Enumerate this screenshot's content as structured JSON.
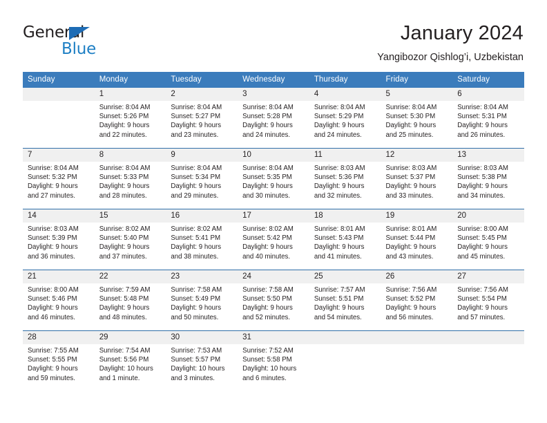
{
  "logo": {
    "word_dark": "General",
    "word_blue": "Blue",
    "triangle_color": "#1e6cb5",
    "blue_color": "#1e7fc4"
  },
  "header": {
    "title": "January 2024",
    "subtitle": "Yangibozor Qishlog’i, Uzbekistan"
  },
  "theme": {
    "header_blue": "#3b7cbc",
    "separator_blue": "#2f6ea8",
    "daynum_band": "#f0f0f0",
    "text": "#231f20"
  },
  "calendar": {
    "weekday_headers": [
      "Sunday",
      "Monday",
      "Tuesday",
      "Wednesday",
      "Thursday",
      "Friday",
      "Saturday"
    ],
    "weeks": [
      [
        {
          "day": "",
          "sunrise": "",
          "sunset": "",
          "daylight_1": "",
          "daylight_2": "",
          "empty": true
        },
        {
          "day": "1",
          "sunrise": "Sunrise: 8:04 AM",
          "sunset": "Sunset: 5:26 PM",
          "daylight_1": "Daylight: 9 hours",
          "daylight_2": "and 22 minutes."
        },
        {
          "day": "2",
          "sunrise": "Sunrise: 8:04 AM",
          "sunset": "Sunset: 5:27 PM",
          "daylight_1": "Daylight: 9 hours",
          "daylight_2": "and 23 minutes."
        },
        {
          "day": "3",
          "sunrise": "Sunrise: 8:04 AM",
          "sunset": "Sunset: 5:28 PM",
          "daylight_1": "Daylight: 9 hours",
          "daylight_2": "and 24 minutes."
        },
        {
          "day": "4",
          "sunrise": "Sunrise: 8:04 AM",
          "sunset": "Sunset: 5:29 PM",
          "daylight_1": "Daylight: 9 hours",
          "daylight_2": "and 24 minutes."
        },
        {
          "day": "5",
          "sunrise": "Sunrise: 8:04 AM",
          "sunset": "Sunset: 5:30 PM",
          "daylight_1": "Daylight: 9 hours",
          "daylight_2": "and 25 minutes."
        },
        {
          "day": "6",
          "sunrise": "Sunrise: 8:04 AM",
          "sunset": "Sunset: 5:31 PM",
          "daylight_1": "Daylight: 9 hours",
          "daylight_2": "and 26 minutes."
        }
      ],
      [
        {
          "day": "7",
          "sunrise": "Sunrise: 8:04 AM",
          "sunset": "Sunset: 5:32 PM",
          "daylight_1": "Daylight: 9 hours",
          "daylight_2": "and 27 minutes."
        },
        {
          "day": "8",
          "sunrise": "Sunrise: 8:04 AM",
          "sunset": "Sunset: 5:33 PM",
          "daylight_1": "Daylight: 9 hours",
          "daylight_2": "and 28 minutes."
        },
        {
          "day": "9",
          "sunrise": "Sunrise: 8:04 AM",
          "sunset": "Sunset: 5:34 PM",
          "daylight_1": "Daylight: 9 hours",
          "daylight_2": "and 29 minutes."
        },
        {
          "day": "10",
          "sunrise": "Sunrise: 8:04 AM",
          "sunset": "Sunset: 5:35 PM",
          "daylight_1": "Daylight: 9 hours",
          "daylight_2": "and 30 minutes."
        },
        {
          "day": "11",
          "sunrise": "Sunrise: 8:03 AM",
          "sunset": "Sunset: 5:36 PM",
          "daylight_1": "Daylight: 9 hours",
          "daylight_2": "and 32 minutes."
        },
        {
          "day": "12",
          "sunrise": "Sunrise: 8:03 AM",
          "sunset": "Sunset: 5:37 PM",
          "daylight_1": "Daylight: 9 hours",
          "daylight_2": "and 33 minutes."
        },
        {
          "day": "13",
          "sunrise": "Sunrise: 8:03 AM",
          "sunset": "Sunset: 5:38 PM",
          "daylight_1": "Daylight: 9 hours",
          "daylight_2": "and 34 minutes."
        }
      ],
      [
        {
          "day": "14",
          "sunrise": "Sunrise: 8:03 AM",
          "sunset": "Sunset: 5:39 PM",
          "daylight_1": "Daylight: 9 hours",
          "daylight_2": "and 36 minutes."
        },
        {
          "day": "15",
          "sunrise": "Sunrise: 8:02 AM",
          "sunset": "Sunset: 5:40 PM",
          "daylight_1": "Daylight: 9 hours",
          "daylight_2": "and 37 minutes."
        },
        {
          "day": "16",
          "sunrise": "Sunrise: 8:02 AM",
          "sunset": "Sunset: 5:41 PM",
          "daylight_1": "Daylight: 9 hours",
          "daylight_2": "and 38 minutes."
        },
        {
          "day": "17",
          "sunrise": "Sunrise: 8:02 AM",
          "sunset": "Sunset: 5:42 PM",
          "daylight_1": "Daylight: 9 hours",
          "daylight_2": "and 40 minutes."
        },
        {
          "day": "18",
          "sunrise": "Sunrise: 8:01 AM",
          "sunset": "Sunset: 5:43 PM",
          "daylight_1": "Daylight: 9 hours",
          "daylight_2": "and 41 minutes."
        },
        {
          "day": "19",
          "sunrise": "Sunrise: 8:01 AM",
          "sunset": "Sunset: 5:44 PM",
          "daylight_1": "Daylight: 9 hours",
          "daylight_2": "and 43 minutes."
        },
        {
          "day": "20",
          "sunrise": "Sunrise: 8:00 AM",
          "sunset": "Sunset: 5:45 PM",
          "daylight_1": "Daylight: 9 hours",
          "daylight_2": "and 45 minutes."
        }
      ],
      [
        {
          "day": "21",
          "sunrise": "Sunrise: 8:00 AM",
          "sunset": "Sunset: 5:46 PM",
          "daylight_1": "Daylight: 9 hours",
          "daylight_2": "and 46 minutes."
        },
        {
          "day": "22",
          "sunrise": "Sunrise: 7:59 AM",
          "sunset": "Sunset: 5:48 PM",
          "daylight_1": "Daylight: 9 hours",
          "daylight_2": "and 48 minutes."
        },
        {
          "day": "23",
          "sunrise": "Sunrise: 7:58 AM",
          "sunset": "Sunset: 5:49 PM",
          "daylight_1": "Daylight: 9 hours",
          "daylight_2": "and 50 minutes."
        },
        {
          "day": "24",
          "sunrise": "Sunrise: 7:58 AM",
          "sunset": "Sunset: 5:50 PM",
          "daylight_1": "Daylight: 9 hours",
          "daylight_2": "and 52 minutes."
        },
        {
          "day": "25",
          "sunrise": "Sunrise: 7:57 AM",
          "sunset": "Sunset: 5:51 PM",
          "daylight_1": "Daylight: 9 hours",
          "daylight_2": "and 54 minutes."
        },
        {
          "day": "26",
          "sunrise": "Sunrise: 7:56 AM",
          "sunset": "Sunset: 5:52 PM",
          "daylight_1": "Daylight: 9 hours",
          "daylight_2": "and 56 minutes."
        },
        {
          "day": "27",
          "sunrise": "Sunrise: 7:56 AM",
          "sunset": "Sunset: 5:54 PM",
          "daylight_1": "Daylight: 9 hours",
          "daylight_2": "and 57 minutes."
        }
      ],
      [
        {
          "day": "28",
          "sunrise": "Sunrise: 7:55 AM",
          "sunset": "Sunset: 5:55 PM",
          "daylight_1": "Daylight: 9 hours",
          "daylight_2": "and 59 minutes."
        },
        {
          "day": "29",
          "sunrise": "Sunrise: 7:54 AM",
          "sunset": "Sunset: 5:56 PM",
          "daylight_1": "Daylight: 10 hours",
          "daylight_2": "and 1 minute."
        },
        {
          "day": "30",
          "sunrise": "Sunrise: 7:53 AM",
          "sunset": "Sunset: 5:57 PM",
          "daylight_1": "Daylight: 10 hours",
          "daylight_2": "and 3 minutes."
        },
        {
          "day": "31",
          "sunrise": "Sunrise: 7:52 AM",
          "sunset": "Sunset: 5:58 PM",
          "daylight_1": "Daylight: 10 hours",
          "daylight_2": "and 6 minutes."
        },
        {
          "day": "",
          "sunrise": "",
          "sunset": "",
          "daylight_1": "",
          "daylight_2": "",
          "empty": true
        },
        {
          "day": "",
          "sunrise": "",
          "sunset": "",
          "daylight_1": "",
          "daylight_2": "",
          "empty": true
        },
        {
          "day": "",
          "sunrise": "",
          "sunset": "",
          "daylight_1": "",
          "daylight_2": "",
          "empty": true
        }
      ]
    ]
  }
}
